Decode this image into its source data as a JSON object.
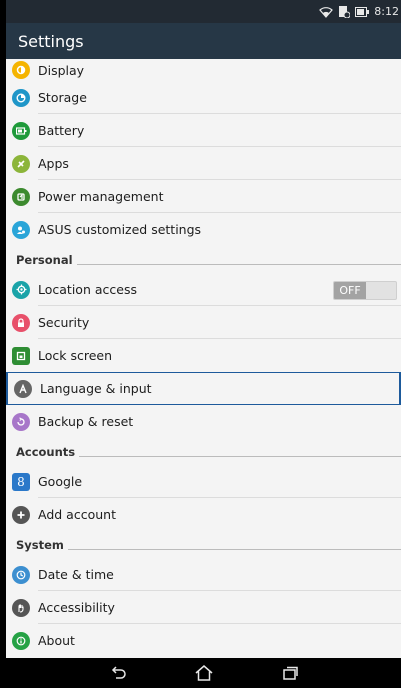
{
  "status_bar": {
    "time": "8:12"
  },
  "app_bar": {
    "title": "Settings"
  },
  "device_items": [
    {
      "label": "Display",
      "icon": "display-icon",
      "color": "#f5b400"
    },
    {
      "label": "Storage",
      "icon": "storage-icon",
      "color": "#1f96c8"
    },
    {
      "label": "Battery",
      "icon": "battery-icon",
      "color": "#1e9a3a"
    },
    {
      "label": "Apps",
      "icon": "apps-icon",
      "color": "#8cb53a"
    },
    {
      "label": "Power management",
      "icon": "power-management-icon",
      "color": "#3c8a2e"
    },
    {
      "label": "ASUS customized settings",
      "icon": "asus-customized-icon",
      "color": "#2aa5d8"
    }
  ],
  "personal": {
    "header": "Personal",
    "items": [
      {
        "label": "Location access",
        "icon": "location-icon",
        "color": "#1aa3a8"
      },
      {
        "label": "Security",
        "icon": "security-icon",
        "color": "#e8506a"
      },
      {
        "label": "Lock screen",
        "icon": "lock-screen-icon",
        "color": "#2e8d33"
      },
      {
        "label": "Language & input",
        "icon": "language-icon",
        "color": "#666666"
      },
      {
        "label": "Backup & reset",
        "icon": "backup-icon",
        "color": "#a776c9"
      }
    ],
    "location_toggle": "OFF"
  },
  "accounts": {
    "header": "Accounts",
    "items": [
      {
        "label": "Google",
        "icon": "google-icon",
        "color": "#2a78c9"
      },
      {
        "label": "Add account",
        "icon": "add-account-icon",
        "color": "#555555"
      }
    ]
  },
  "system": {
    "header": "System",
    "items": [
      {
        "label": "Date & time",
        "icon": "date-time-icon",
        "color": "#3c8fd0"
      },
      {
        "label": "Accessibility",
        "icon": "accessibility-icon",
        "color": "#555555"
      },
      {
        "label": "About",
        "icon": "about-icon",
        "color": "#25a245"
      }
    ]
  },
  "colors": {
    "app_bar": "#263746",
    "status_bar": "#222a33",
    "selection": "#1d5a9b"
  }
}
